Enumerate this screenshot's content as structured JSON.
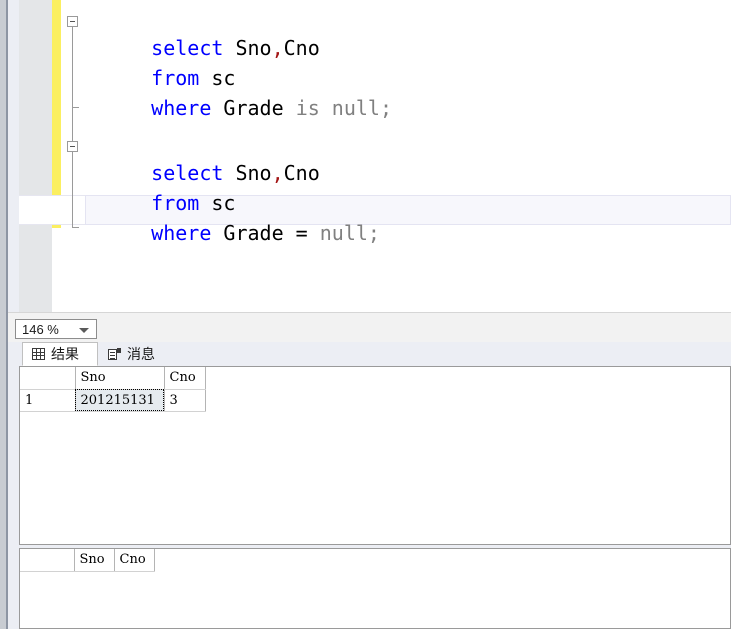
{
  "editor": {
    "zoom_level": "146 %",
    "zoom_icon": "chevron-down-icon",
    "change_bar_color": "#fbef60",
    "keyword_color": "#0000ff",
    "literal_color": "#808080",
    "punctuation_color": "#a31515",
    "blocks": [
      {
        "fold_state": "expanded",
        "fold_glyph": "minus-box-icon",
        "lines": [
          {
            "segments": [
              {
                "text": "select",
                "kind": "keyword"
              },
              {
                "text": " ",
                "kind": "plain"
              },
              {
                "text": "Sno",
                "kind": "plain"
              },
              {
                "text": ",",
                "kind": "punct"
              },
              {
                "text": "Cno",
                "kind": "plain"
              }
            ]
          },
          {
            "segments": [
              {
                "text": "from",
                "kind": "keyword"
              },
              {
                "text": " sc",
                "kind": "plain"
              }
            ]
          },
          {
            "segments": [
              {
                "text": "where",
                "kind": "keyword"
              },
              {
                "text": " Grade ",
                "kind": "plain"
              },
              {
                "text": "is null;",
                "kind": "literal"
              }
            ]
          }
        ]
      },
      {
        "fold_state": "expanded",
        "fold_glyph": "minus-box-icon",
        "lines": [
          {
            "segments": [
              {
                "text": "select",
                "kind": "keyword"
              },
              {
                "text": " ",
                "kind": "plain"
              },
              {
                "text": "Sno",
                "kind": "plain"
              },
              {
                "text": ",",
                "kind": "punct"
              },
              {
                "text": "Cno",
                "kind": "plain"
              }
            ]
          },
          {
            "segments": [
              {
                "text": "from",
                "kind": "keyword"
              },
              {
                "text": " sc",
                "kind": "plain"
              }
            ]
          },
          {
            "segments": [
              {
                "text": "where",
                "kind": "keyword"
              },
              {
                "text": " Grade = ",
                "kind": "plain"
              },
              {
                "text": "null;",
                "kind": "literal"
              }
            ],
            "current": true
          }
        ]
      }
    ],
    "raw_lines": [
      "select Sno,Cno",
      "  from sc",
      "  where Grade is null;",
      "",
      "select Sno,Cno",
      "  from sc",
      "  where Grade = null;"
    ]
  },
  "results_tabs": [
    {
      "id": "results",
      "label": "结果",
      "icon": "grid-icon",
      "active": true
    },
    {
      "id": "messages",
      "label": "消息",
      "icon": "message-icon",
      "active": false
    }
  ],
  "result_grids": [
    {
      "name": "result-grid-1",
      "columns": [
        "",
        "Sno",
        "Cno"
      ],
      "rows": [
        {
          "rownum": "1",
          "cells": [
            "201215131",
            "3"
          ],
          "selected_cell_index": 0
        }
      ]
    },
    {
      "name": "result-grid-2",
      "columns": [
        "",
        "Sno",
        "Cno"
      ],
      "rows": []
    }
  ]
}
